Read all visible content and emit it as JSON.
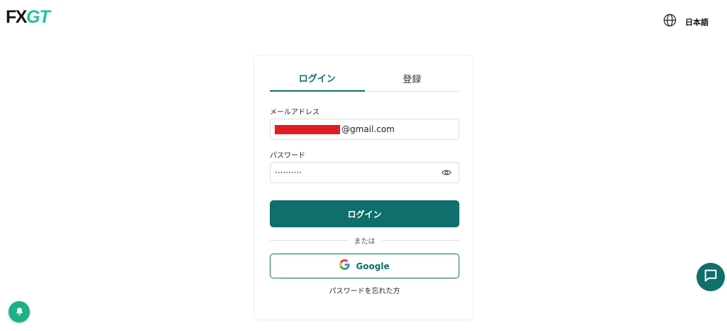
{
  "header": {
    "logo_primary": "FX",
    "logo_accent": "GT",
    "language_label": "日本語",
    "language_icon": "globe-icon"
  },
  "auth": {
    "tabs": [
      {
        "label": "ログイン",
        "active": true
      },
      {
        "label": "登録",
        "active": false
      }
    ],
    "email_label": "メールアドレス",
    "email_value_suffix": "@gmail.com",
    "password_label": "パスワード",
    "password_value": "··········",
    "password_toggle_icon": "eye-icon",
    "login_button": "ログイン",
    "divider_text": "または",
    "google_button": "Google",
    "google_icon": "google-icon",
    "forgot_password": "パスワードを忘れた方"
  },
  "floating": {
    "notification_icon": "bell-icon",
    "chat_icon": "chat-bubble-icon"
  },
  "colors": {
    "brand": "#0e6f6c",
    "logo_accent": "#1fc39d",
    "notification": "#1db187",
    "redaction": "#e31b23"
  }
}
